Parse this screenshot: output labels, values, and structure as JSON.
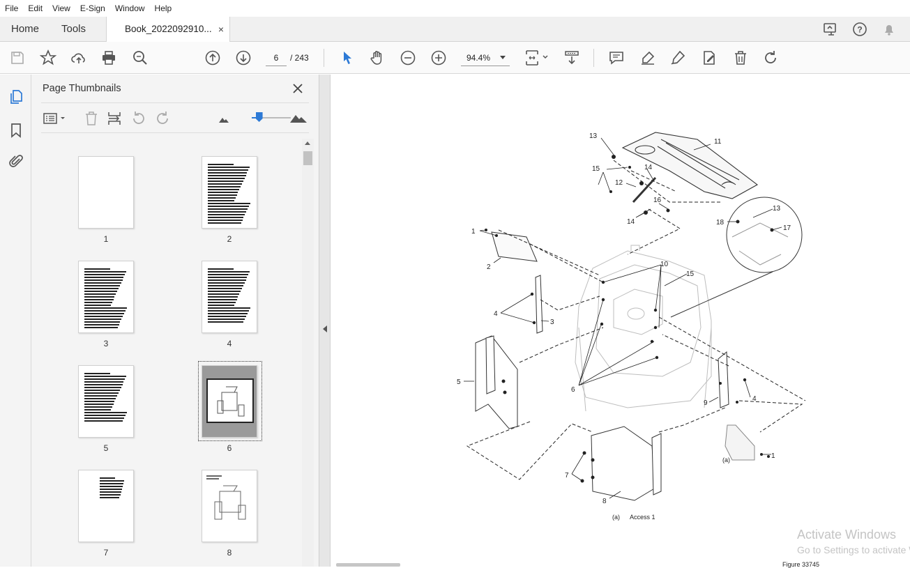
{
  "menu": [
    "File",
    "Edit",
    "View",
    "E-Sign",
    "Window",
    "Help"
  ],
  "tabs": {
    "home": "Home",
    "tools": "Tools",
    "document": "Book_2022092910...",
    "close": "×"
  },
  "toolbar": {
    "current_page": "6",
    "total_pages": "/ 243",
    "zoom": "94.4%"
  },
  "panel": {
    "title": "Page Thumbnails",
    "thumbnails": [
      "1",
      "2",
      "3",
      "4",
      "5",
      "6",
      "7",
      "8"
    ],
    "selected_page": "6",
    "thumbnail_size_fraction": 0.1
  },
  "drawing": {
    "callouts": [
      "1",
      "2",
      "3",
      "4",
      "5",
      "6",
      "7",
      "8",
      "9",
      "10",
      "11",
      "12",
      "13",
      "14",
      "15",
      "16",
      "17",
      "18"
    ],
    "caption_label": "(a)",
    "caption_text": "Access 1",
    "detail_label": "(a)",
    "figure_number": "Figure 33745"
  },
  "watermark": {
    "line1": "Activate Windows",
    "line2": "Go to Settings to activate Windows."
  },
  "colors": {
    "accent": "#2d7ad6",
    "panel_bg": "#f4f4f4"
  }
}
